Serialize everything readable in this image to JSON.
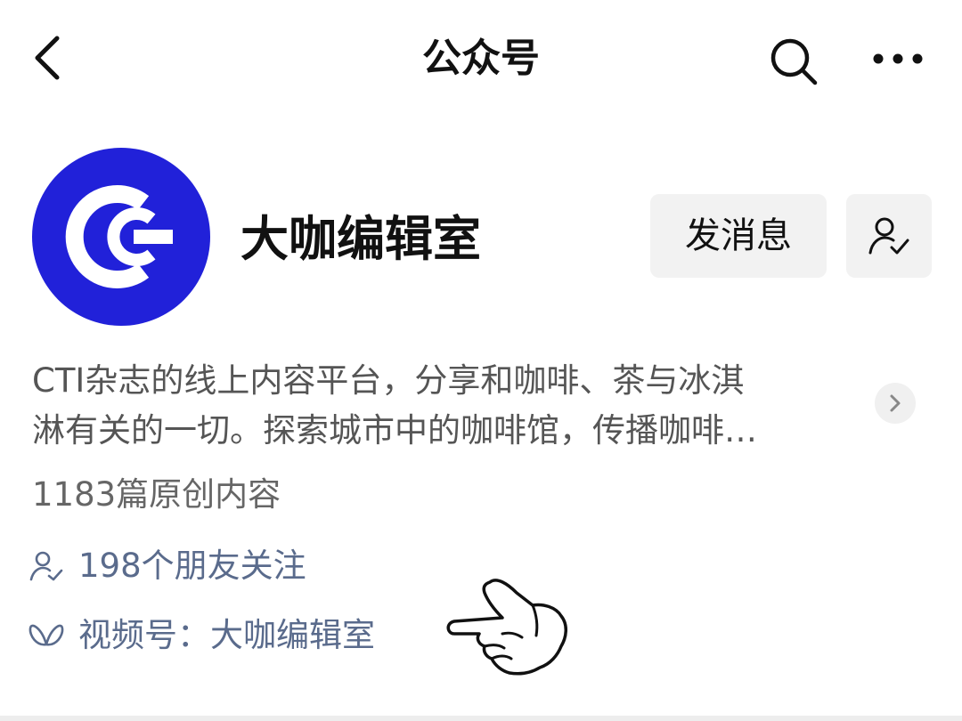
{
  "header": {
    "title": "公众号",
    "back_icon": "chevron-left-icon",
    "search_icon": "search-icon",
    "more_icon": "more-dots-icon"
  },
  "profile": {
    "name": "大咖编辑室",
    "avatar_brand_color": "#2121d9",
    "message_button": "发消息",
    "follow_icon": "user-check-icon"
  },
  "description": {
    "line1": "CTI杂志的线上内容平台，分享和咖啡、茶与冰淇",
    "line2": "淋有关的一切。探索城市中的咖啡馆，传播咖啡…"
  },
  "stats": {
    "articles": "1183篇原创内容"
  },
  "links": {
    "friends": "198个朋友关注",
    "channels": "视频号：大咖编辑室",
    "link_color": "#5a6b8c"
  }
}
